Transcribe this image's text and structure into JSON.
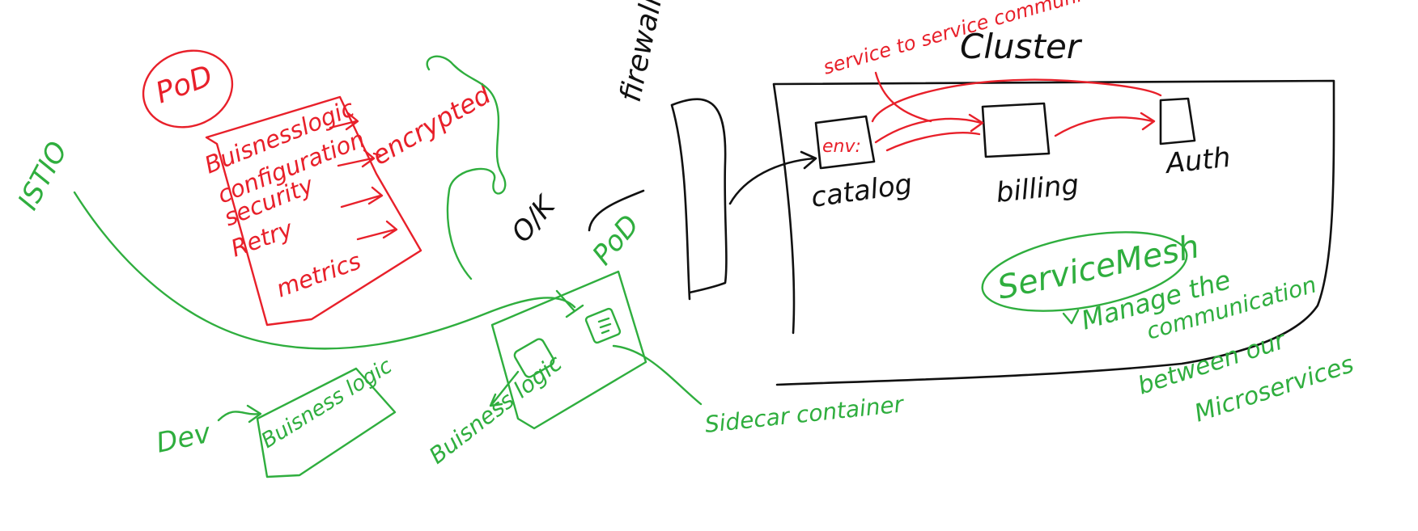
{
  "colors": {
    "red": "#e8202a",
    "green": "#2fae3e",
    "black": "#111111"
  },
  "labels": {
    "pod_top": "PoD",
    "pod_list": [
      "Buisnesslogic",
      "configuration",
      "security",
      "Retry",
      "metrics"
    ],
    "encrypted": "encrypted",
    "istio": "ISTIO",
    "ok": "O/K",
    "pod_mid": "PoD",
    "dev": "Dev",
    "dev_box": "Buisness logic",
    "business_logic": "Buisness logic",
    "sidecar": "Sidecar container",
    "firewall": "firewall",
    "service_to_service": "service to service communication",
    "cluster": "Cluster",
    "env": "env:",
    "catalog": "catalog",
    "billing": "billing",
    "auth": "Auth",
    "service_mesh": "ServiceMesh",
    "manage": "Manage the",
    "communication": "communication",
    "between": "between our",
    "microservices": "Microservices"
  }
}
